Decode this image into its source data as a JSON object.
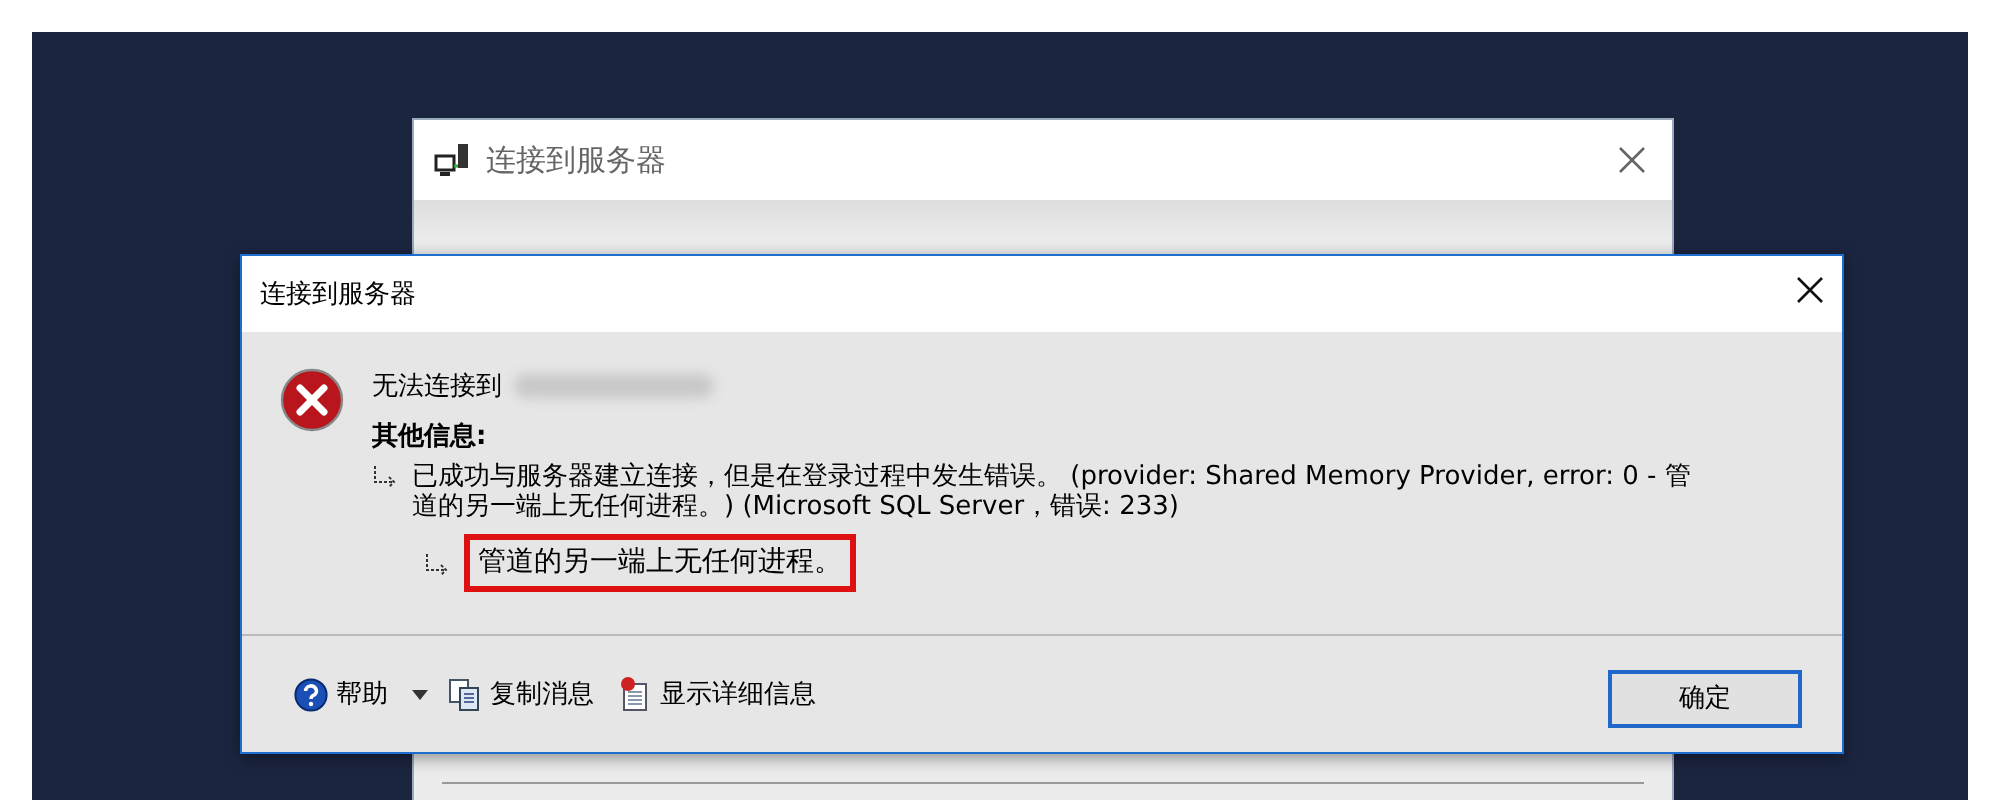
{
  "back_window": {
    "title": "连接到服务器"
  },
  "dialog": {
    "title": "连接到服务器",
    "heading": "无法连接到",
    "info_label": "其他信息:",
    "details": [
      {
        "text": "已成功与服务器建立连接，但是在登录过程中发生错误。 (provider: Shared Memory Provider, error: 0 - 管道的另一端上无任何进程。) (Microsoft SQL Server，错误: 233)",
        "highlighted": false,
        "children": [
          {
            "text": "管道的另一端上无任何进程。",
            "highlighted": true
          }
        ]
      }
    ],
    "footer_buttons": [
      {
        "label": "帮助",
        "kind": "help"
      },
      {
        "label": "复制消息",
        "kind": "copy"
      },
      {
        "label": "显示详细信息",
        "kind": "details"
      }
    ],
    "ok_button": "确定"
  }
}
